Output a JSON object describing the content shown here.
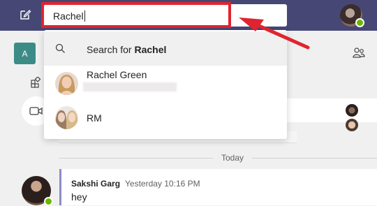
{
  "search": {
    "query": "Rachel"
  },
  "suggestions": {
    "search_prefix": "Search for ",
    "search_term": "Rachel",
    "people": [
      {
        "name": "Rachel Green"
      },
      {
        "name": "RM"
      }
    ]
  },
  "sidebar": {
    "team_initial": "A"
  },
  "chat": {
    "day_divider": "Today",
    "message": {
      "author": "Sakshi Garg",
      "time": "Yesterday 10:16 PM",
      "text": "hey"
    }
  },
  "colors": {
    "topbar": "#464775",
    "highlight_box": "#e0242f",
    "presence": "#6bb700",
    "team_tile": "#3d8b86"
  },
  "icons": [
    "compose-icon",
    "search-icon",
    "apps-icon",
    "meet-now-icon",
    "people-icon",
    "annotation-arrow"
  ]
}
